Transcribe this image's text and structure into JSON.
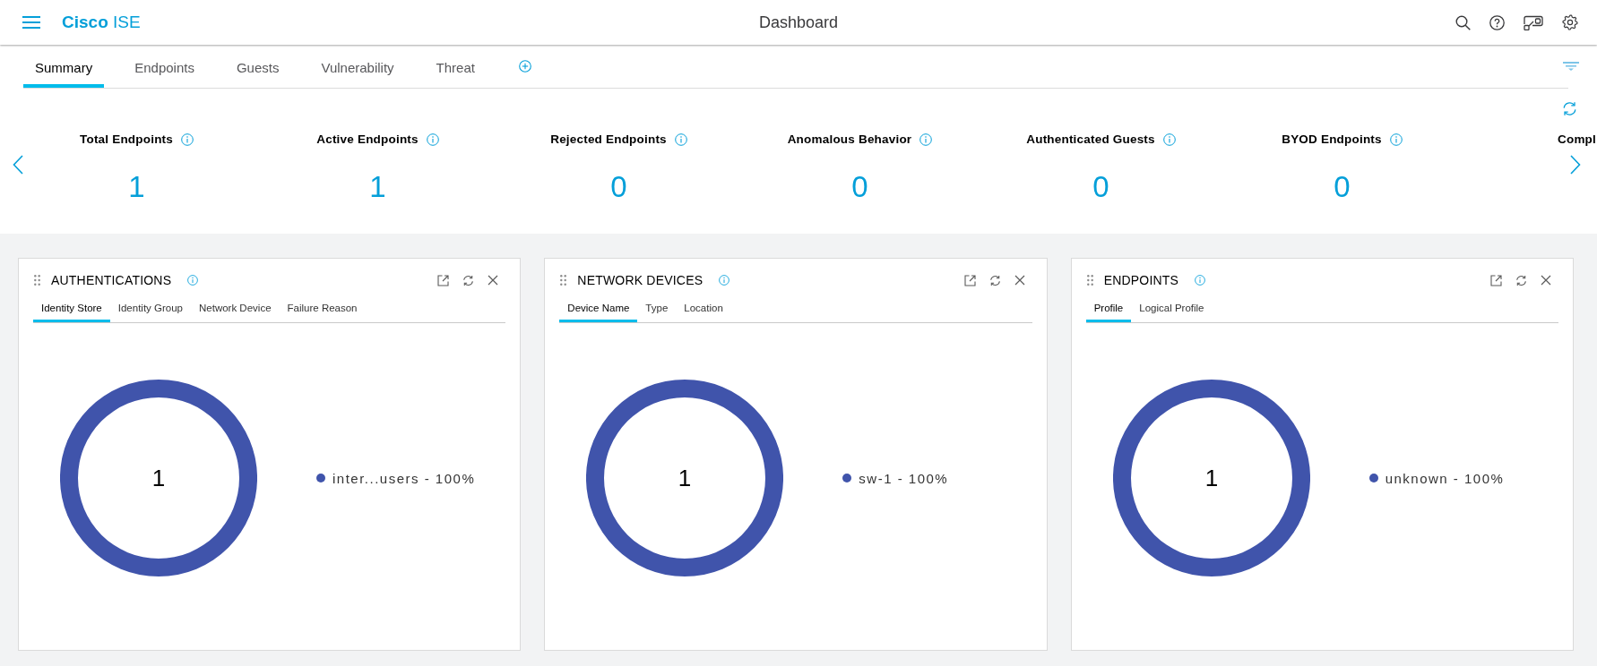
{
  "header": {
    "brand": "**Cisco** ISE",
    "title": "Dashboard"
  },
  "tabs": [
    {
      "label": "Summary",
      "selected": true
    },
    {
      "label": "Endpoints",
      "selected": false
    },
    {
      "label": "Guests",
      "selected": false
    },
    {
      "label": "Vulnerability",
      "selected": false
    },
    {
      "label": "Threat",
      "selected": false
    }
  ],
  "metrics": [
    {
      "label": "Total Endpoints",
      "value": "1"
    },
    {
      "label": "Active Endpoints",
      "value": "1"
    },
    {
      "label": "Rejected Endpoints",
      "value": "0"
    },
    {
      "label": "Anomalous Behavior",
      "value": "0"
    },
    {
      "label": "Authenticated Guests",
      "value": "0"
    },
    {
      "label": "BYOD Endpoints",
      "value": "0"
    }
  ],
  "partial_metric": {
    "label": "Compl"
  },
  "cards": [
    {
      "title": "AUTHENTICATIONS",
      "tabs": [
        {
          "label": "Identity Store",
          "selected": true
        },
        {
          "label": "Identity Group",
          "selected": false
        },
        {
          "label": "Network Device",
          "selected": false
        },
        {
          "label": "Failure Reason",
          "selected": false
        }
      ],
      "center_value": "1",
      "legend": [
        {
          "label": "inter...users - 100%",
          "color": "#4054ab"
        }
      ]
    },
    {
      "title": "NETWORK DEVICES",
      "tabs": [
        {
          "label": "Device Name",
          "selected": true
        },
        {
          "label": "Type",
          "selected": false
        },
        {
          "label": "Location",
          "selected": false
        }
      ],
      "center_value": "1",
      "legend": [
        {
          "label": "sw-1 - 100%",
          "color": "#4054ab"
        }
      ]
    },
    {
      "title": "ENDPOINTS",
      "tabs": [
        {
          "label": "Profile",
          "selected": true
        },
        {
          "label": "Logical Profile",
          "selected": false
        }
      ],
      "center_value": "1",
      "legend": [
        {
          "label": "unknown - 100%",
          "color": "#4054ab"
        }
      ]
    }
  ]
}
